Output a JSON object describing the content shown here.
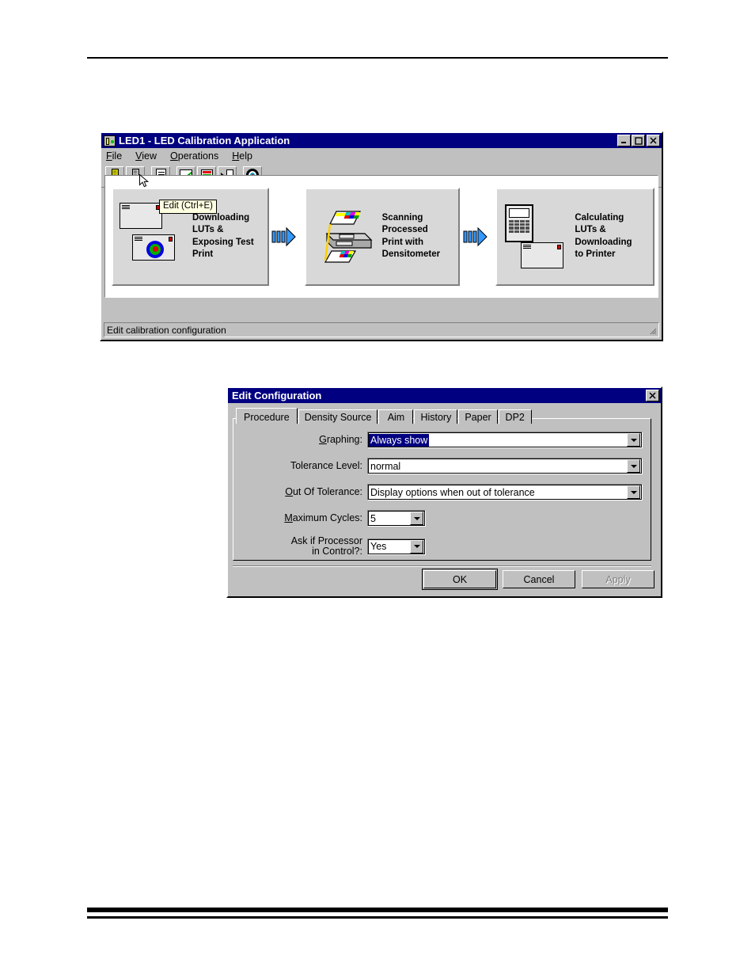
{
  "app_window": {
    "title": "LED1 - LED Calibration Application",
    "icon": "led-app-icon",
    "title_buttons": [
      {
        "name": "minimize-button",
        "glyph": "_"
      },
      {
        "name": "maximize-button",
        "glyph": "□"
      },
      {
        "name": "close-button",
        "glyph": "✕"
      }
    ],
    "menu": [
      {
        "name": "menu-file",
        "label": "File",
        "accel": "F"
      },
      {
        "name": "menu-view",
        "label": "View",
        "accel": "V"
      },
      {
        "name": "menu-operations",
        "label": "Operations",
        "accel": "O"
      },
      {
        "name": "menu-help",
        "label": "Help",
        "accel": "H"
      }
    ],
    "toolbar": [
      {
        "name": "start-calibration-button",
        "icon": "traffic-light-green-icon"
      },
      {
        "name": "stop-calibration-button",
        "icon": "traffic-light-disabled-icon"
      },
      {
        "name": "edit-configuration-button",
        "icon": "edit-document-icon"
      },
      {
        "name": "view-graph-button",
        "icon": "line-graph-icon"
      },
      {
        "name": "view-density-button",
        "icon": "rgb-bars-icon"
      },
      {
        "name": "download-lut-button",
        "icon": "download-document-icon"
      },
      {
        "name": "target-button",
        "icon": "bullseye-target-icon"
      }
    ],
    "tooltip": "Edit (Ctrl+E)",
    "status_text": "Edit calibration configuration",
    "workflow": [
      {
        "name": "stage-downloading-luts",
        "text": "Downloading\nLUTs &\nExposing Test\nPrint",
        "icon": "printer-windows-icon"
      },
      {
        "name": "stage-scanning-print",
        "text": "Scanning\nProcessed\nPrint with\nDensitometer",
        "icon": "densitometer-scanner-icon"
      },
      {
        "name": "stage-calculating-luts",
        "text": "Calculating\nLUTs &\nDownloading\nto Printer",
        "icon": "calculator-window-icon"
      }
    ],
    "arrow_icon": "blue-right-arrow-icon"
  },
  "dialog": {
    "title": "Edit Configuration",
    "close_glyph": "✕",
    "tabs": [
      {
        "name": "tab-procedure",
        "label": "Procedure",
        "active": true
      },
      {
        "name": "tab-density-source",
        "label": "Density Source",
        "active": false
      },
      {
        "name": "tab-aim",
        "label": "Aim",
        "active": false
      },
      {
        "name": "tab-history",
        "label": "History",
        "active": false
      },
      {
        "name": "tab-paper",
        "label": "Paper",
        "active": false
      },
      {
        "name": "tab-dp2",
        "label": "DP2",
        "active": false
      }
    ],
    "fields": [
      {
        "name": "graphing-field",
        "label": "Graphing:",
        "accel": "G",
        "value": "Always show",
        "selected": true
      },
      {
        "name": "tolerance-level-field",
        "label": "Tolerance Level:",
        "accel": "",
        "value": "normal",
        "selected": false
      },
      {
        "name": "out-of-tolerance-field",
        "label": "Out Of Tolerance:",
        "accel": "O",
        "value": "Display options when out of tolerance",
        "selected": false
      },
      {
        "name": "maximum-cycles-field",
        "label": "Maximum Cycles:",
        "accel": "M",
        "value": "5",
        "selected": false
      },
      {
        "name": "ask-if-processor-in-control-field",
        "label": "Ask if Processor\nin Control?:",
        "accel": "",
        "value": "Yes",
        "selected": false
      }
    ],
    "buttons": [
      {
        "name": "ok-button",
        "label": "OK",
        "state": "default"
      },
      {
        "name": "cancel-button",
        "label": "Cancel",
        "state": "normal"
      },
      {
        "name": "apply-button",
        "label": "Apply",
        "state": "disabled"
      }
    ]
  },
  "colors": {
    "titlebar": "#000080",
    "face": "#c0c0c0",
    "tooltip_bg": "#ffffe1",
    "arrow_blue": "#3399ff",
    "highlight": "#000080"
  }
}
